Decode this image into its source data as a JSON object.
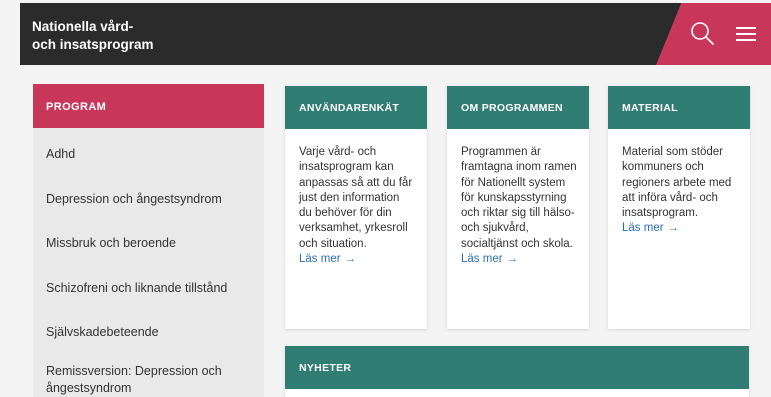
{
  "header": {
    "title_line1": "Nationella vård-",
    "title_line2": "och insatsprogram",
    "accent_color": "#c8375a",
    "bg_color": "#2b2b2b",
    "icons": [
      "search-icon",
      "hamburger-menu-icon"
    ]
  },
  "sidebar": {
    "heading": "PROGRAM",
    "items": [
      {
        "label": "Adhd"
      },
      {
        "label": "Depression och ångestsyndrom"
      },
      {
        "label": "Missbruk och beroende"
      },
      {
        "label": "Schizofreni och liknande tillstånd"
      },
      {
        "label": "Självskadebeteende"
      },
      {
        "label": "Remissversion: Depression och ångestsyndrom"
      }
    ]
  },
  "cards": [
    {
      "heading": "ANVÄNDARENKÄT",
      "body": "Varje vård- och insatsprogram kan anpassas så att du får just den information du behöver för din verksamhet, yrkesroll och situation.",
      "link": "Läs mer",
      "arrow": "→"
    },
    {
      "heading": "OM PROGRAMMEN",
      "body": "Programmen är framtagna inom ramen för Nationellt system för kunskapsstyrning och riktar sig till hälso- och sjukvård, socialtjänst och skola.",
      "link": "Läs mer",
      "arrow": "→"
    },
    {
      "heading": "MATERIAL",
      "body": "Material som stöder kommuners och regioners arbete med att införa vård- och insatsprogram.",
      "link": "Läs mer",
      "arrow": "→"
    }
  ],
  "news": {
    "heading": "NYHETER"
  },
  "colors": {
    "teal": "#2f7d73",
    "pink": "#c8375a",
    "link": "#2a6fb8"
  }
}
